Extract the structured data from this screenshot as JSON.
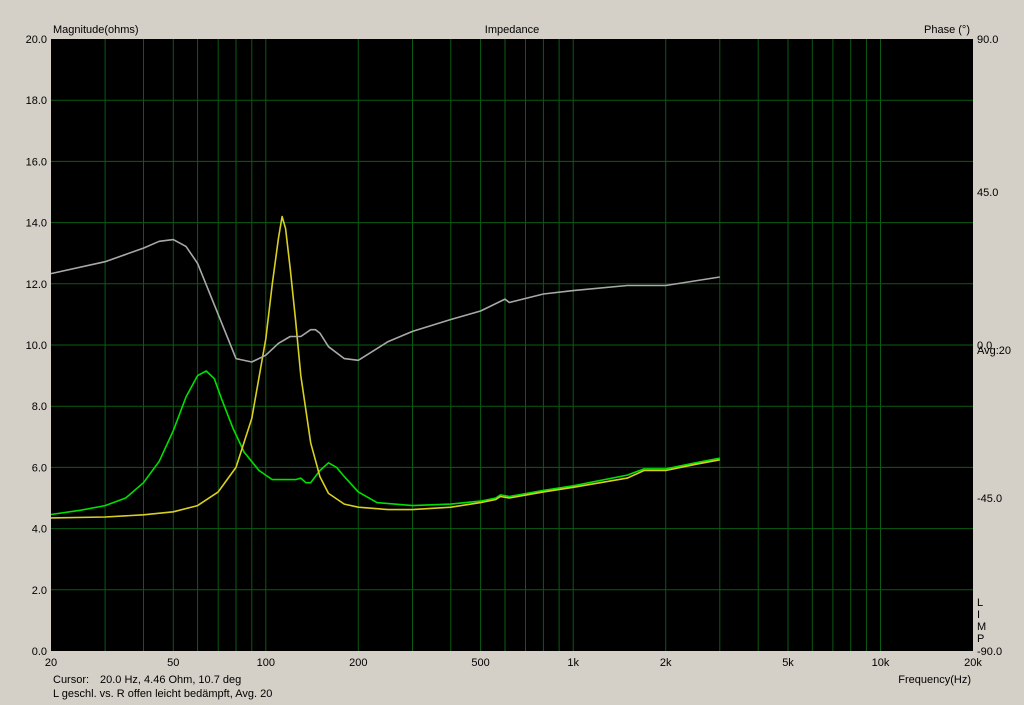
{
  "header": {
    "left_axis_label": "Magnitude(ohms)",
    "title": "Impedance",
    "right_axis_label": "Phase (°)"
  },
  "footer": {
    "cursor_label": "Cursor:",
    "cursor_value": "20.0 Hz, 4.46 Ohm, 10.7 deg",
    "caption": "L geschl. vs. R offen leicht bedämpft, Avg. 20",
    "x_axis_label": "Frequency(Hz)"
  },
  "side": {
    "avg_label": "Avg:20",
    "limp_letters": [
      "L",
      "I",
      "M",
      "P"
    ]
  },
  "colors": {
    "background": "#d4d0c8",
    "plot_bg": "#000000",
    "grid": "#0b5b12",
    "green_trace": "#00e000",
    "yellow_trace": "#d8d020",
    "phase_trace": "#a8a8a8"
  },
  "chart_data": {
    "type": "line",
    "title": "Impedance",
    "xlabel": "Frequency(Hz)",
    "ylabel": "Magnitude(ohms)",
    "y2label": "Phase (°)",
    "x_scale": "log",
    "xlim": [
      20,
      20000
    ],
    "ylim": [
      0,
      20
    ],
    "y2lim": [
      -90,
      90
    ],
    "grid": true,
    "x_ticks": [
      20,
      50,
      100,
      200,
      500,
      1000,
      2000,
      5000,
      10000,
      20000
    ],
    "x_tick_labels": [
      "20",
      "50",
      "100",
      "200",
      "500",
      "1k",
      "2k",
      "5k",
      "10k",
      "20k"
    ],
    "y_ticks": [
      0,
      2,
      4,
      6,
      8,
      10,
      12,
      14,
      16,
      18,
      20
    ],
    "y_tick_labels": [
      "0.0",
      "2.0",
      "4.0",
      "6.0",
      "8.0",
      "10.0",
      "12.0",
      "14.0",
      "16.0",
      "18.0",
      "20.0"
    ],
    "y2_ticks": [
      -90,
      -45,
      0,
      45,
      90
    ],
    "y2_tick_labels": [
      "-90.0",
      "-45.0",
      "0.0",
      "45.0",
      "90.0"
    ],
    "series": [
      {
        "color": "#00e000",
        "x": [
          20,
          25,
          30,
          35,
          40,
          45,
          50,
          55,
          60,
          64,
          68,
          72,
          78,
          85,
          95,
          105,
          115,
          125,
          130,
          135,
          140,
          150,
          160,
          170,
          180,
          200,
          230,
          300,
          400,
          500,
          560,
          580,
          620,
          800,
          1000,
          1500,
          1700,
          2000,
          2500,
          3000
        ],
        "y": [
          4.46,
          4.6,
          4.75,
          5.0,
          5.5,
          6.2,
          7.2,
          8.3,
          9.0,
          9.15,
          8.9,
          8.2,
          7.3,
          6.5,
          5.9,
          5.6,
          5.6,
          5.6,
          5.65,
          5.5,
          5.5,
          5.9,
          6.15,
          6.0,
          5.7,
          5.2,
          4.85,
          4.75,
          4.8,
          4.9,
          5.0,
          5.1,
          5.05,
          5.25,
          5.4,
          5.75,
          5.95,
          5.95,
          6.15,
          6.3
        ]
      },
      {
        "color": "#d8d020",
        "x": [
          20,
          30,
          40,
          50,
          60,
          70,
          80,
          90,
          100,
          105,
          110,
          113,
          116,
          120,
          125,
          130,
          140,
          150,
          160,
          180,
          200,
          250,
          300,
          400,
          500,
          560,
          580,
          620,
          800,
          1000,
          1500,
          1700,
          2000,
          2500,
          3000
        ],
        "y": [
          4.35,
          4.38,
          4.45,
          4.55,
          4.75,
          5.2,
          6.0,
          7.6,
          10.2,
          12.0,
          13.5,
          14.2,
          13.8,
          12.5,
          10.8,
          9.0,
          6.8,
          5.7,
          5.15,
          4.8,
          4.7,
          4.62,
          4.62,
          4.7,
          4.85,
          4.95,
          5.05,
          5.0,
          5.2,
          5.35,
          5.65,
          5.9,
          5.9,
          6.1,
          6.25
        ]
      },
      {
        "color": "#a8a8a8",
        "axis": "right",
        "x": [
          20,
          30,
          40,
          45,
          50,
          55,
          60,
          70,
          80,
          90,
          100,
          110,
          120,
          130,
          140,
          145,
          150,
          160,
          180,
          200,
          250,
          300,
          400,
          500,
          600,
          620,
          800,
          1000,
          1500,
          2000,
          3000
        ],
        "y": [
          21,
          24.5,
          28.5,
          30.5,
          31,
          29,
          24,
          9,
          -4,
          -5,
          -3,
          0.5,
          2.5,
          2.5,
          4.5,
          4.5,
          3.5,
          -0.5,
          -4,
          -4.5,
          1,
          4,
          7.5,
          10,
          13.5,
          12.5,
          15,
          16,
          17.5,
          17.5,
          20
        ]
      }
    ]
  }
}
